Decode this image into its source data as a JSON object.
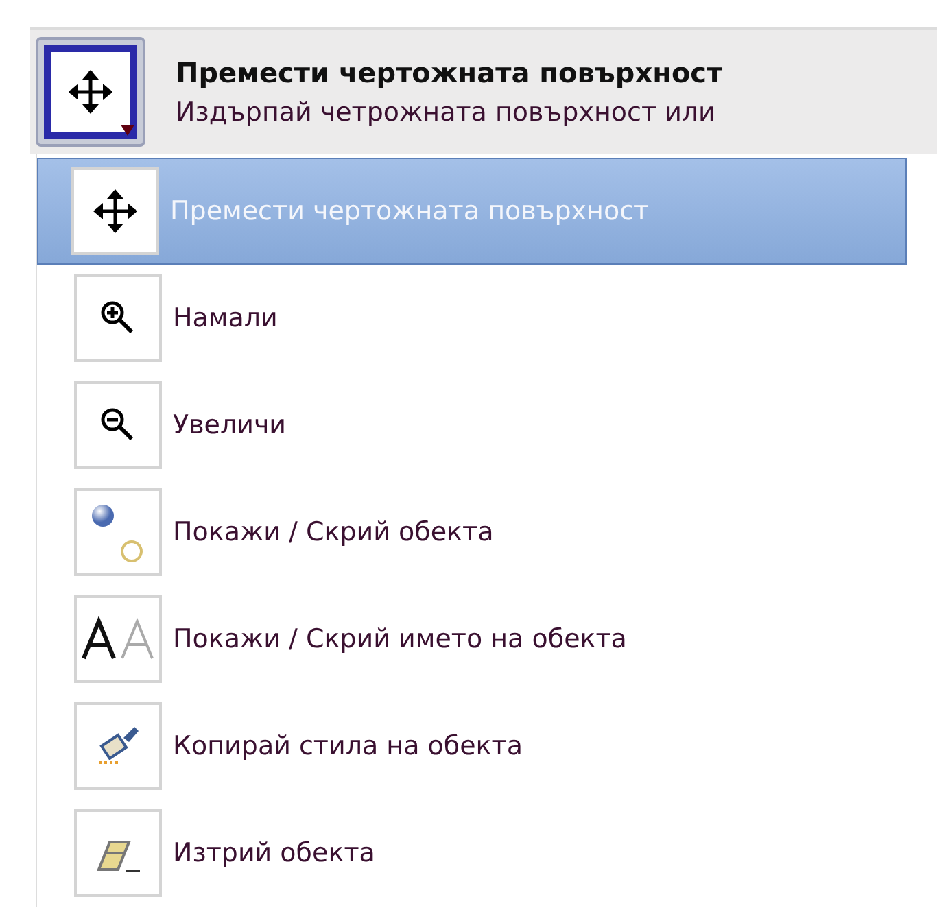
{
  "tool_button": {
    "kind": "move",
    "title": "Премести чертожната повърхност",
    "description": "Издърпай четрожната повърхност или"
  },
  "menu": [
    {
      "kind": "move",
      "label": "Премести чертожната повърхност",
      "selected": true
    },
    {
      "kind": "zoom-in",
      "label": "Намали",
      "selected": false
    },
    {
      "kind": "zoom-out",
      "label": "Увеличи",
      "selected": false
    },
    {
      "kind": "show-hide",
      "label": "Покажи / Скрий обекта",
      "selected": false
    },
    {
      "kind": "label",
      "label": "Покажи / Скрий името на обекта",
      "selected": false
    },
    {
      "kind": "copy-style",
      "label": "Копирай стила на обекта",
      "selected": false
    },
    {
      "kind": "delete",
      "label": "Изтрий обекта",
      "selected": false
    }
  ]
}
